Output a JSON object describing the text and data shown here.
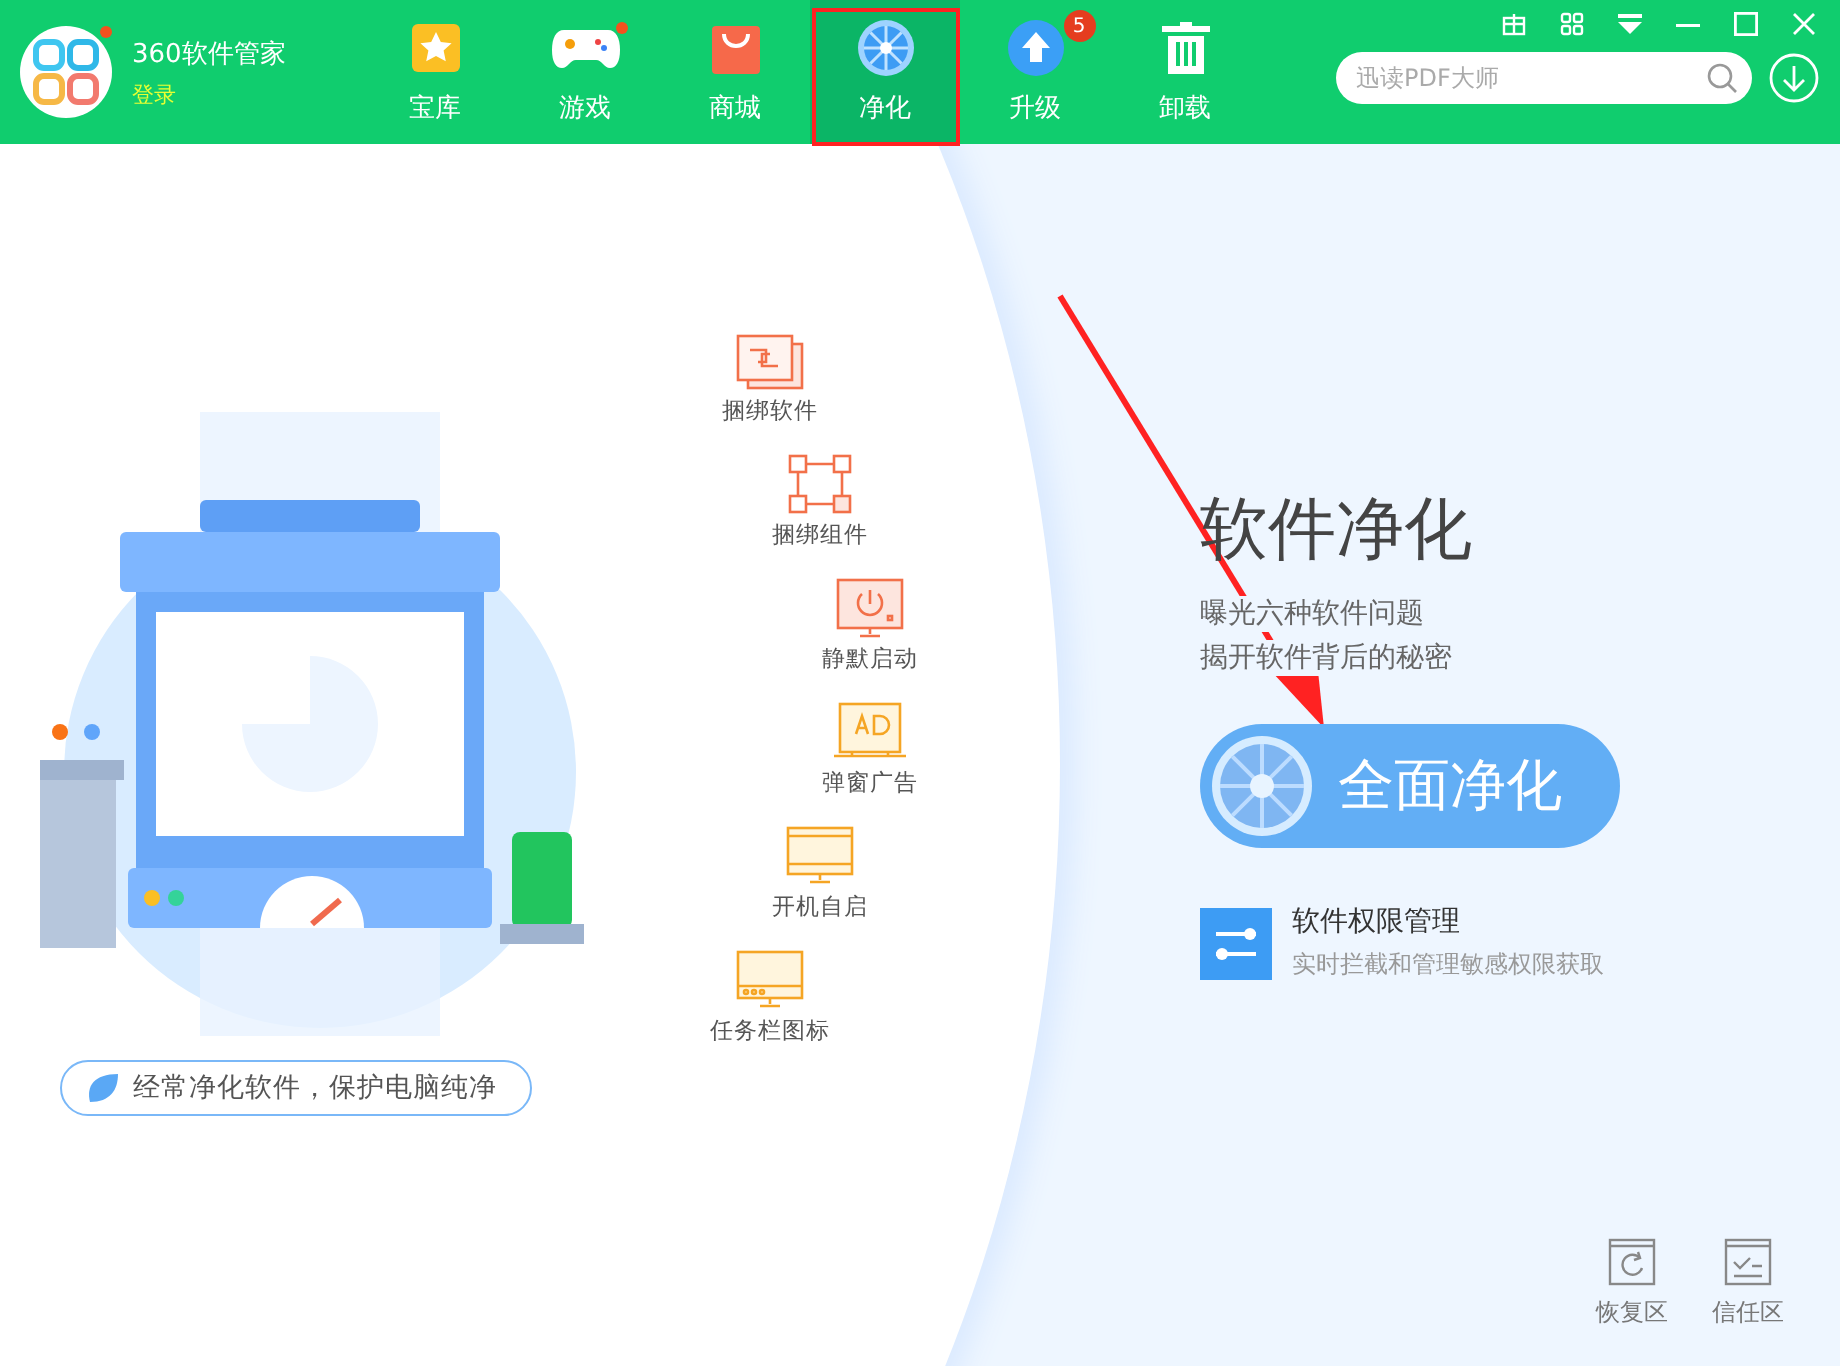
{
  "app": {
    "name": "360软件管家",
    "login": "登录",
    "notify": true
  },
  "nav": [
    {
      "label": "宝库",
      "kind": "store",
      "selected": false,
      "dot": false
    },
    {
      "label": "游戏",
      "kind": "game",
      "selected": false,
      "dot": true
    },
    {
      "label": "商城",
      "kind": "shop",
      "selected": false,
      "dot": false
    },
    {
      "label": "净化",
      "kind": "clean",
      "selected": true,
      "dot": false
    },
    {
      "label": "升级",
      "kind": "upgrade",
      "selected": false,
      "dot": false,
      "badge": "5"
    },
    {
      "label": "卸载",
      "kind": "uninstall",
      "selected": false,
      "dot": false
    }
  ],
  "search": {
    "placeholder": "迅读PDF大师"
  },
  "features": [
    {
      "label": "捆绑软件",
      "kind": "bundle"
    },
    {
      "label": "捆绑组件",
      "kind": "component"
    },
    {
      "label": "静默启动",
      "kind": "silent"
    },
    {
      "label": "弹窗广告",
      "kind": "ad"
    },
    {
      "label": "开机自启",
      "kind": "boot"
    },
    {
      "label": "任务栏图标",
      "kind": "taskbar"
    }
  ],
  "slogan": "经常净化软件，保护电脑纯净",
  "title": "软件净化",
  "desc": [
    "曝光六种软件问题",
    "揭开软件背后的秘密"
  ],
  "primary_button": "全面净化",
  "permission": {
    "title": "软件权限管理",
    "subtitle": "实时拦截和管理敏感权限获取"
  },
  "bottom_links": [
    {
      "label": "恢复区",
      "kind": "restore"
    },
    {
      "label": "信任区",
      "kind": "trust"
    }
  ]
}
